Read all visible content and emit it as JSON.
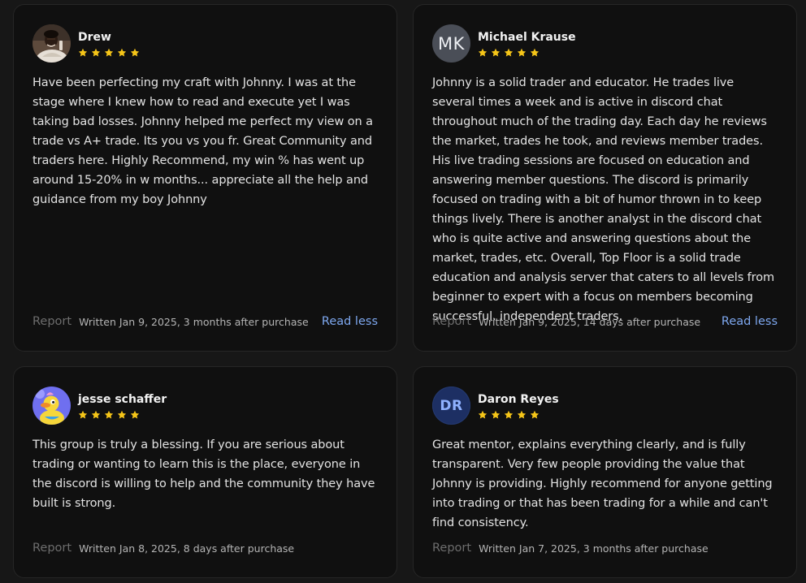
{
  "reviews": [
    {
      "name": "Drew",
      "avatar": "photo-avatar-man",
      "rating": 5,
      "text": "Have been perfecting my craft with Johnny. I was at the stage where I knew how to read and execute yet I was taking bad losses. Johnny helped me perfect my view on a trade vs A+ trade. Its you vs you fr. Great Community and traders here. Highly Recommend, my win % has went up around 15-20% in w months... appreciate all the help and guidance from my boy Johnny",
      "report_label": "Report",
      "written": "Written Jan 9, 2025, 3 months after purchase",
      "toggle_label": "Read less"
    },
    {
      "name": "Michael Krause",
      "avatar_initials": "MK",
      "rating": 5,
      "text": "Johnny is a solid trader and educator. He trades live several times a week and is active in discord chat throughout much of the trading day. Each day he reviews the market, trades he took, and reviews member trades. His live trading sessions are focused on education and answering member questions. The discord is primarily focused on trading with a bit of humor thrown in to keep things lively. There is another analyst in the discord chat who is quite active and answering questions about the market, trades, etc. Overall, Top Floor is a solid trade education and analysis server that caters to all levels from beginner to expert with a focus on members becoming successful, independent traders.",
      "report_label": "Report",
      "written": "Written Jan 9, 2025, 14 days after purchase",
      "toggle_label": "Read less"
    },
    {
      "name": "jesse schaffer",
      "avatar": "cartoon-duck-avatar",
      "rating": 5,
      "text": "This group is truly a blessing. If you are serious about trading or wanting to learn this is the place, everyone in the discord is willing to help and the community they have built is strong.",
      "report_label": "Report",
      "written": "Written Jan 8, 2025, 8 days after purchase"
    },
    {
      "name": "Daron Reyes",
      "avatar_initials": "DR",
      "rating": 5,
      "text": "Great mentor, explains everything clearly, and is fully transparent. Very few people providing the value that Johnny is providing. Highly recommend for anyone getting into trading or that has been trading for a while and can't find consistency.",
      "report_label": "Report",
      "written": "Written Jan 7, 2025, 3 months after purchase"
    }
  ],
  "colors": {
    "page_background": "#171717",
    "card_background": "#101010",
    "star": "#f5c518",
    "link": "#7ea8f0",
    "muted": "#6d6d6d"
  }
}
